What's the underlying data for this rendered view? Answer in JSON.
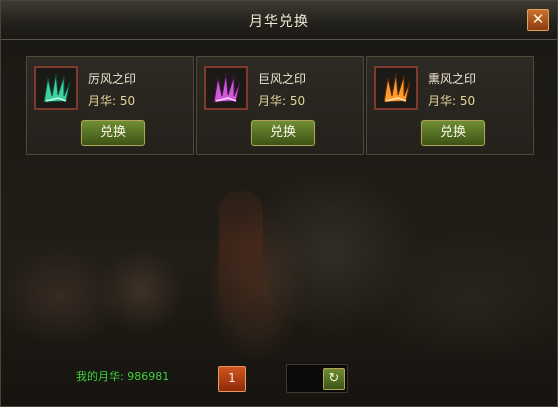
{
  "window": {
    "title": "月华兑换",
    "close_icon": "close-icon"
  },
  "items": [
    {
      "name": "厉风之印",
      "price": "月华: 50",
      "button": "兑换",
      "icon": "green-wing-icon",
      "color": "#3fd0a0"
    },
    {
      "name": "巨风之印",
      "price": "月华: 50",
      "button": "兑换",
      "icon": "purple-wing-icon",
      "color": "#d05ad8"
    },
    {
      "name": "熏风之印",
      "price": "月华: 50",
      "button": "兑换",
      "icon": "orange-wing-icon",
      "color": "#ff9a2a"
    }
  ],
  "footer": {
    "my_yuehua": "我的月华: 986981",
    "page": "1",
    "refresh_icon": "refresh-icon"
  }
}
